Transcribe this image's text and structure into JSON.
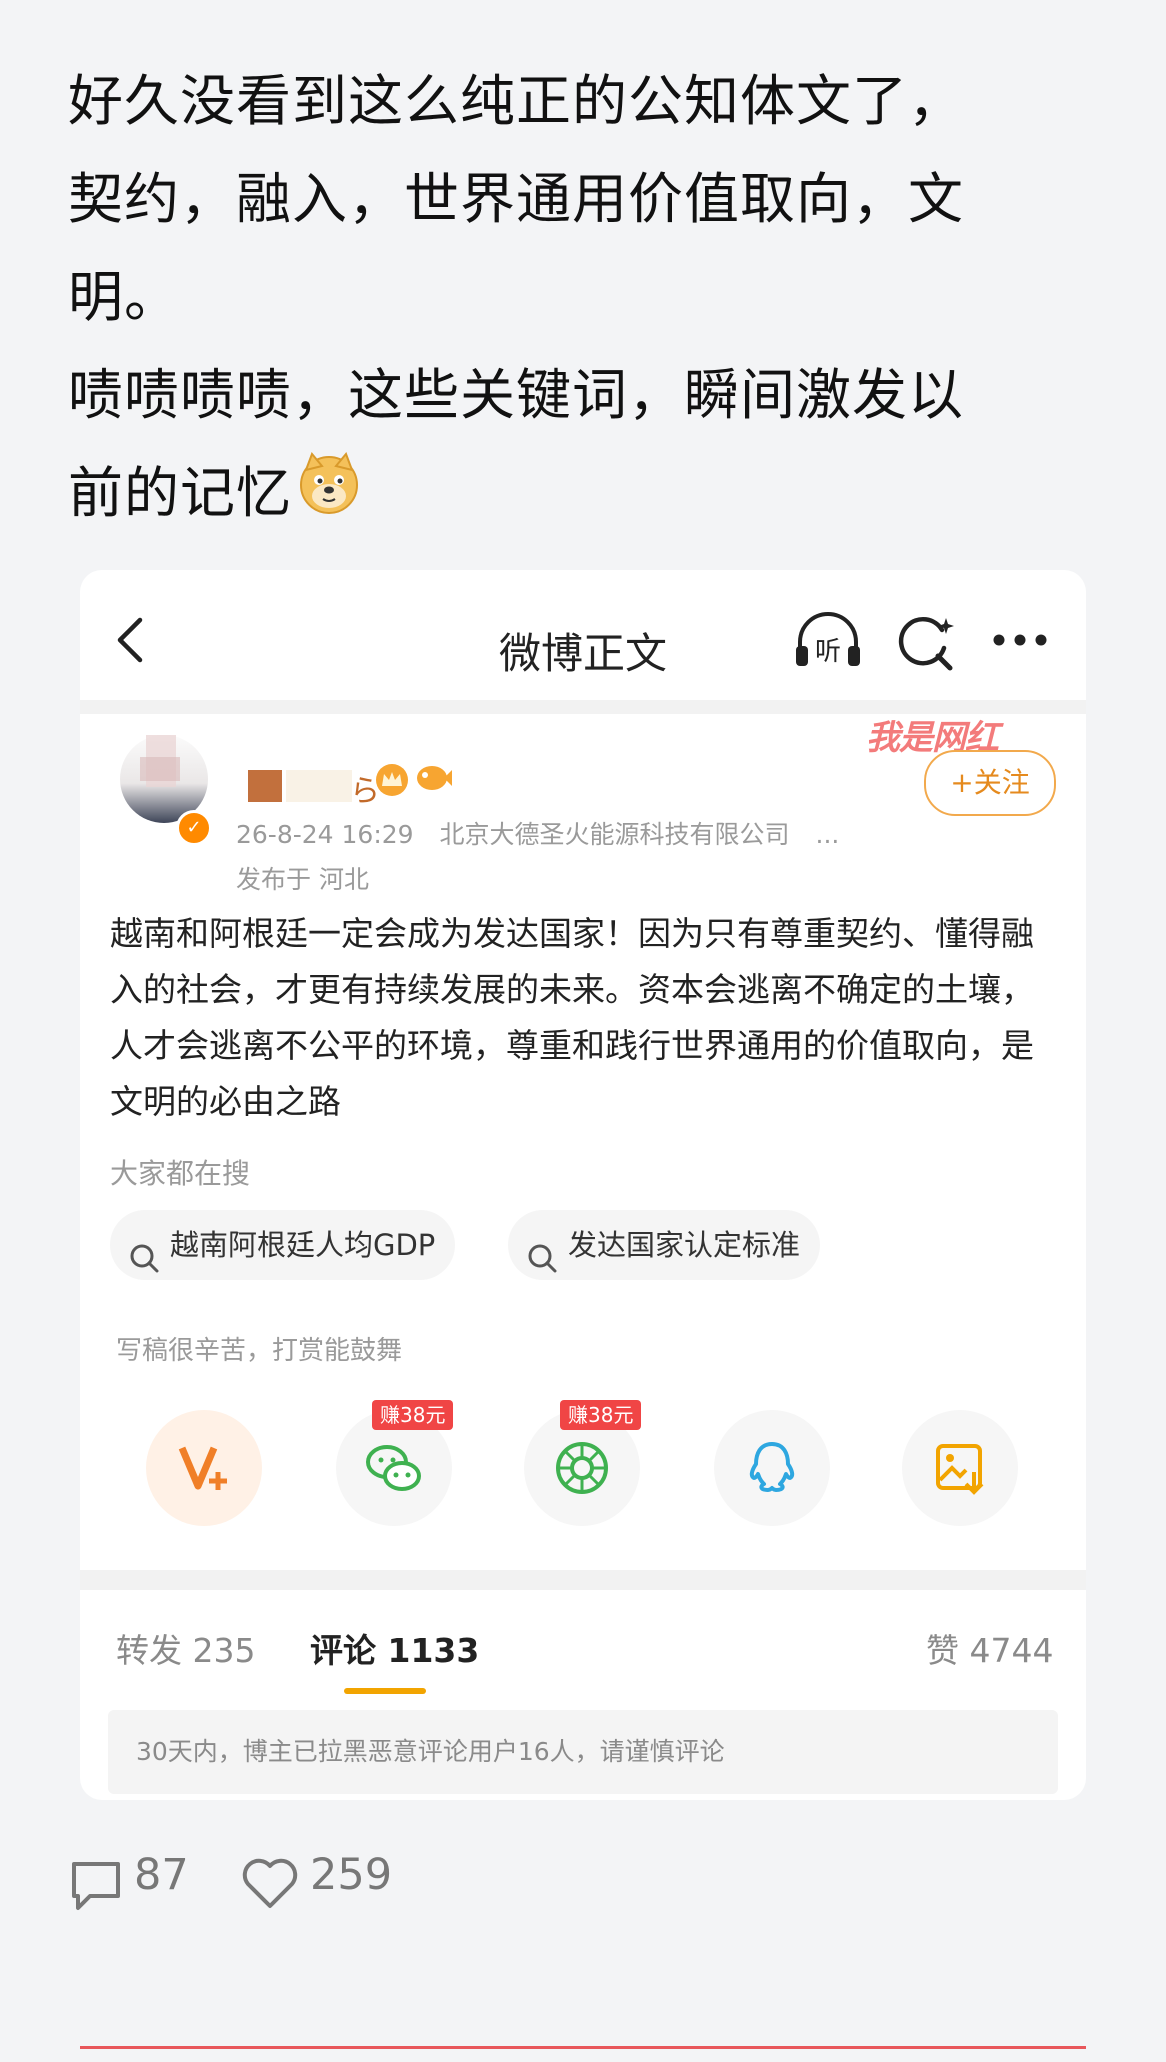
{
  "post": {
    "lines": [
      "好久没看到这么纯正的公知体文了，",
      "契约，融入，世界通用价值取向，文",
      "明。",
      "啧啧啧啧，这些关键词，瞬间激发以",
      "前的记忆"
    ],
    "emoji": "doge-emoji"
  },
  "screenshot": {
    "topbar": {
      "title": "微博正文",
      "icons": [
        "back-icon",
        "listen-icon",
        "search-ai-icon",
        "more-icon"
      ]
    },
    "author": {
      "username_partial": "ら",
      "watermark": "我是网红",
      "follow_label": "+关注",
      "time": "26-8-24 16:29",
      "source": "北京大德圣火能源科技有限公司",
      "ellipsis": "...",
      "location": "发布于 河北"
    },
    "body": "越南和阿根廷一定会成为发达国家！因为只有尊重契约、懂得融入的社会，才更有持续发展的未来。资本会逃离不确定的土壤，人才会逃离不公平的环境，尊重和践行世界通用的价值取向，是文明的必由之路",
    "search": {
      "label": "大家都在搜",
      "chips": [
        "越南阿根廷人均GDP",
        "发达国家认定标准"
      ]
    },
    "reward_label": "写稿很辛苦，打赏能鼓舞",
    "share_badges": [
      "赚38元",
      "赚38元"
    ],
    "stats": {
      "repost": "转发 235",
      "comment": "评论 1133",
      "like": "赞 4744"
    },
    "notice": "30天内，博主已拉黑恶意评论用户16人，请谨慎评论"
  },
  "footer": {
    "comments": "87",
    "likes": "259"
  }
}
